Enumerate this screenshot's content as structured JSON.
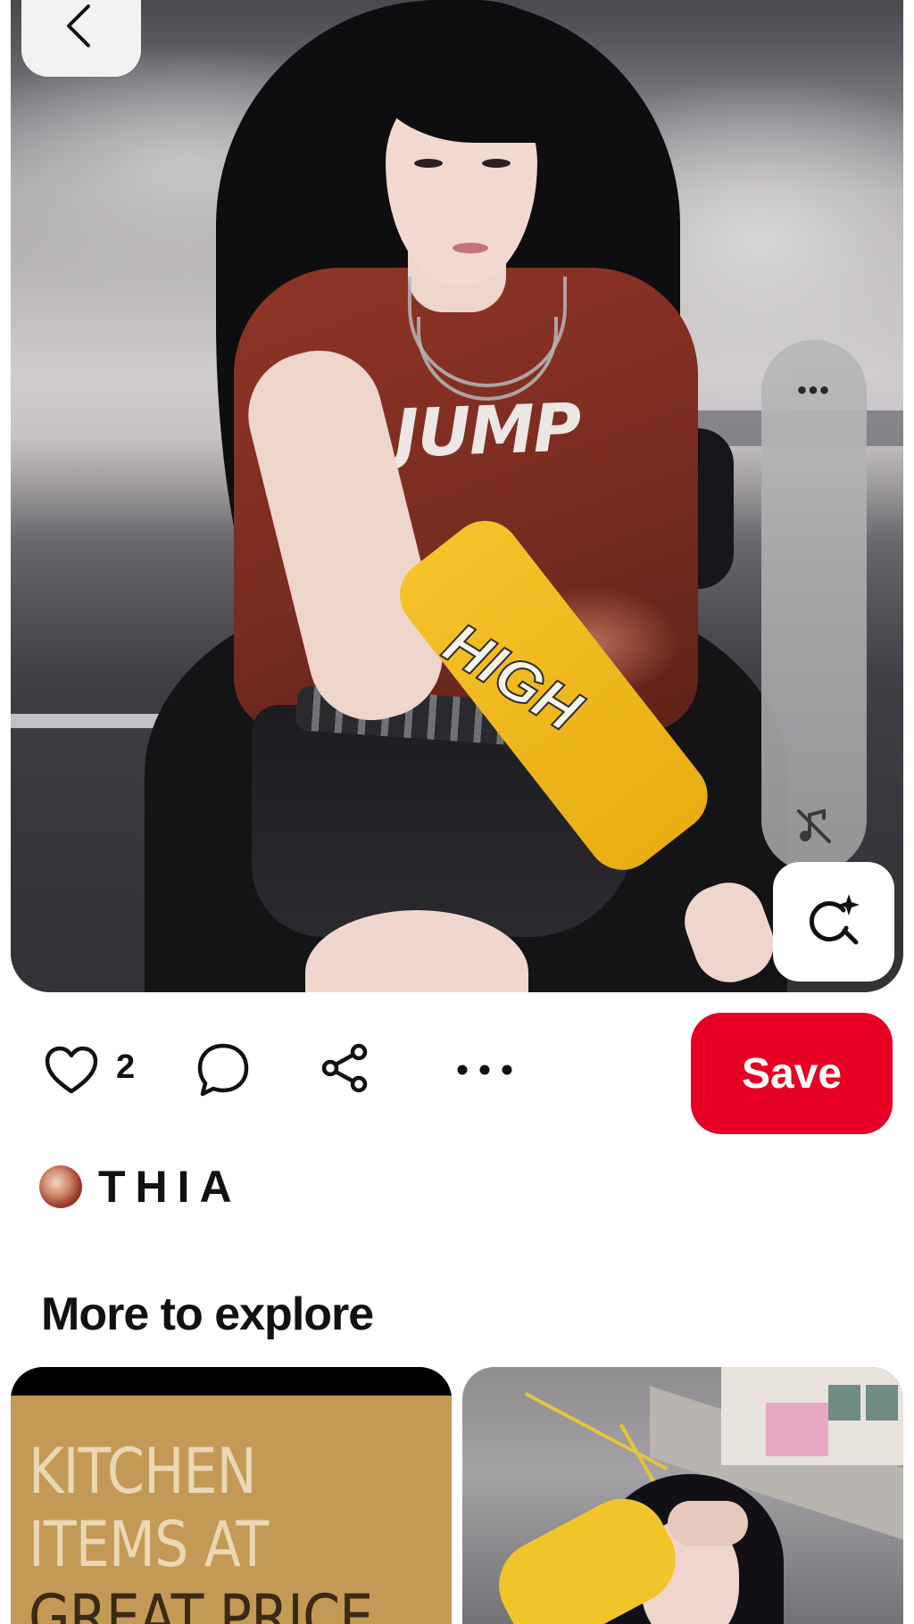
{
  "pin": {
    "shirt_print": "JUMP",
    "sleeve_print": "HIGH",
    "side_panel": {
      "more_label": "•••"
    }
  },
  "actions": {
    "like_count": "2",
    "more_label": "•••",
    "save_label": "Save"
  },
  "author": {
    "name": "THIA"
  },
  "explore": {
    "title": "More to explore",
    "cards": [
      {
        "kind": "ad",
        "lines": [
          "KITCHEN",
          "ITEMS AT",
          "GREAT PRICE"
        ]
      },
      {
        "kind": "photo"
      }
    ]
  },
  "icons": {
    "back": "chevron-left-icon",
    "mute": "music-muted-icon",
    "lens": "visual-search-sparkle-icon",
    "like": "heart-icon",
    "comment": "comment-bubble-icon",
    "share": "share-icon",
    "more": "more-dots-icon"
  },
  "colors": {
    "save_button": "#e60023",
    "ad_background": "#c39a55"
  }
}
